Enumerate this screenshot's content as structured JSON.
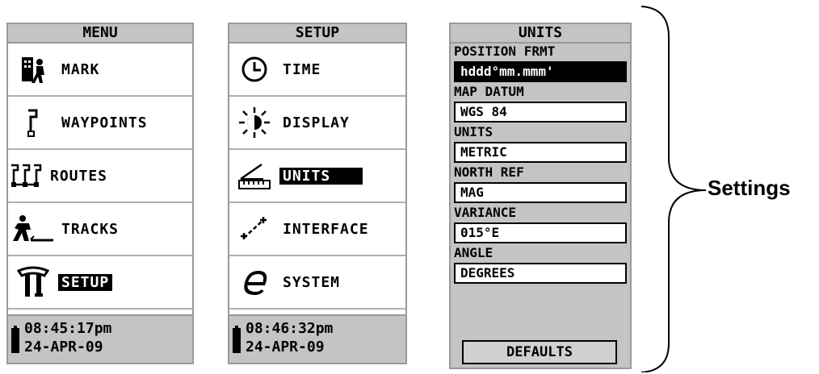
{
  "menu": {
    "title": "MENU",
    "items": [
      {
        "label": "MARK",
        "icon": "mark-icon"
      },
      {
        "label": "WAYPOINTS",
        "icon": "waypoint-flag-icon"
      },
      {
        "label": "ROUTES",
        "icon": "routes-icon"
      },
      {
        "label": "TRACKS",
        "icon": "tracks-icon"
      },
      {
        "label": "SETUP",
        "icon": "setup-tools-icon",
        "selected": true
      }
    ],
    "status": {
      "time": "08:45:17pm",
      "date": "24-APR-09"
    }
  },
  "setup": {
    "title": "SETUP",
    "items": [
      {
        "label": "TIME",
        "icon": "clock-icon"
      },
      {
        "label": "DISPLAY",
        "icon": "sun-icon"
      },
      {
        "label": "UNITS",
        "icon": "ruler-icon",
        "selected": true
      },
      {
        "label": "INTERFACE",
        "icon": "interface-icon"
      },
      {
        "label": "SYSTEM",
        "icon": "system-icon"
      }
    ],
    "status": {
      "time": "08:46:32pm",
      "date": "24-APR-09"
    }
  },
  "units": {
    "title": "UNITS",
    "fields": [
      {
        "label": "POSITION FRMT",
        "value": "hddd°mm.mmm'",
        "selected": true
      },
      {
        "label": "MAP DATUM",
        "value": "WGS 84"
      },
      {
        "label": "UNITS",
        "value": "METRIC"
      },
      {
        "label": "NORTH REF",
        "value": "MAG"
      },
      {
        "label": "VARIANCE",
        "value": "015°E"
      },
      {
        "label": "ANGLE",
        "value": "DEGREES"
      }
    ],
    "defaults_label": "DEFAULTS"
  },
  "annotation": {
    "label": "Settings"
  },
  "colors": {
    "title_bar": "#c4c4c4",
    "border": "#999999",
    "selection": "#000000"
  }
}
